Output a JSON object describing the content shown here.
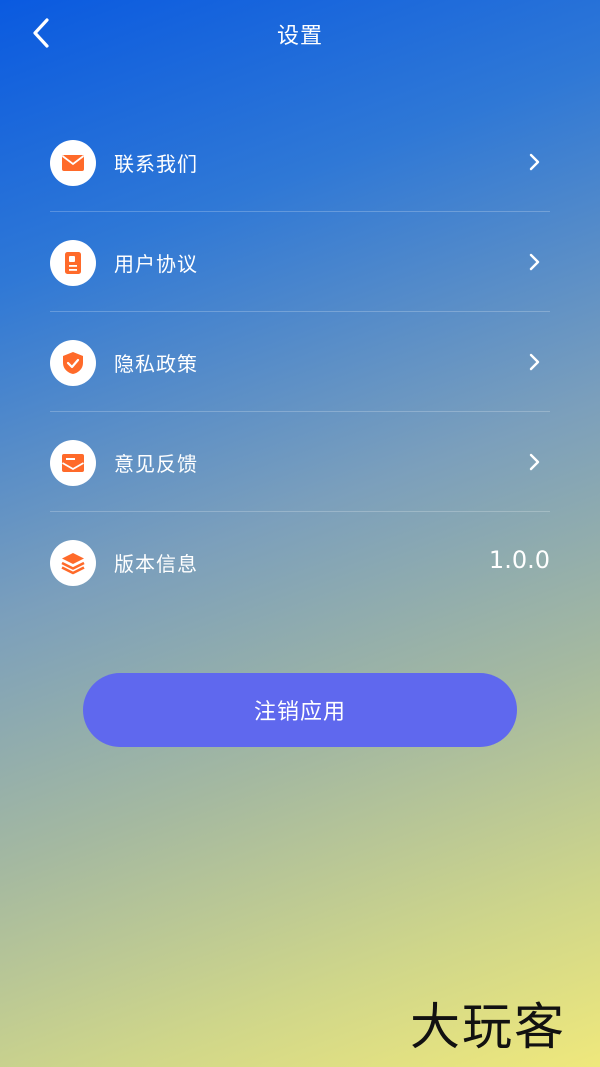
{
  "header": {
    "title": "设置",
    "back_icon": "chevron-left-icon"
  },
  "menu": {
    "items": [
      {
        "label": "联系我们",
        "icon": "mail-icon",
        "has_chevron": true
      },
      {
        "label": "用户协议",
        "icon": "document-icon",
        "has_chevron": true
      },
      {
        "label": "隐私政策",
        "icon": "shield-check-icon",
        "has_chevron": true
      },
      {
        "label": "意见反馈",
        "icon": "feedback-mail-icon",
        "has_chevron": true
      },
      {
        "label": "版本信息",
        "icon": "layers-icon",
        "value": "1.0.0"
      }
    ]
  },
  "actions": {
    "logout_label": "注销应用"
  },
  "watermark": {
    "text": "大玩客"
  },
  "colors": {
    "icon_accent": "#ff6a2a",
    "button_bg": "#5f68ee",
    "gradient_top": "#0a5ae0",
    "gradient_bottom": "#efe87c"
  }
}
